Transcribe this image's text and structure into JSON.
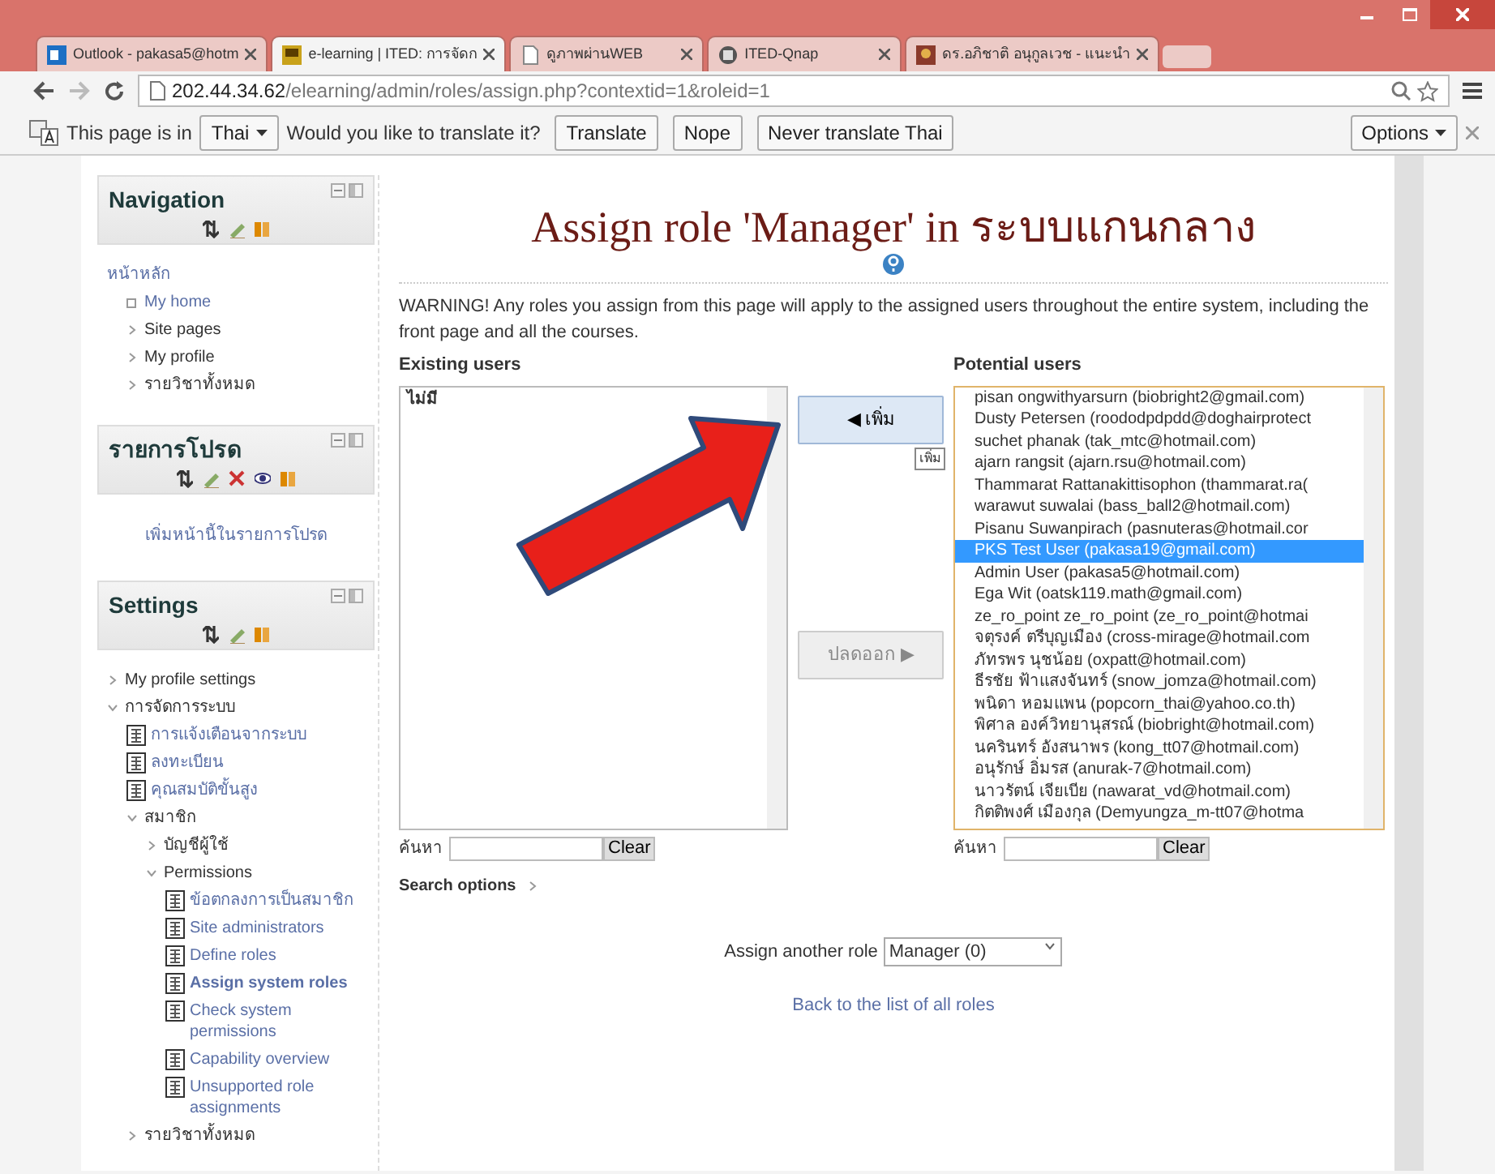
{
  "browser": {
    "tabs": [
      {
        "title": "Outlook - pakasa5@hotm",
        "selected": false,
        "kind": "mail"
      },
      {
        "title": "e-learning | ITED: การจัดก",
        "selected": true,
        "kind": "site"
      },
      {
        "title": "ดูภาพผ่านWEB",
        "selected": false,
        "kind": "page"
      },
      {
        "title": "ITED-Qnap",
        "selected": false,
        "kind": "nas"
      },
      {
        "title": "ดร.อภิชาติ อนุกูลเวช - แนะนำ",
        "selected": false,
        "kind": "photo"
      }
    ],
    "address_host": "202.44.34.62",
    "address_path": "/elearning/admin/roles/assign.php?contextid=1&roleid=1"
  },
  "translate_bar": {
    "text_1": "This page is in",
    "language": "Thai",
    "text_2": "Would you like to translate it?",
    "buttons": [
      "Translate",
      "Nope",
      "Never translate Thai"
    ],
    "options": "Options"
  },
  "sidebar": [
    {
      "title": "Navigation",
      "kind": "plain",
      "items": [
        {
          "label": "หน้าหลัก",
          "kind": "link",
          "children": [
            {
              "label": "My home",
              "kind": "leaf"
            },
            {
              "label": "Site pages",
              "kind": "branch",
              "expanded": false
            },
            {
              "label": "My profile",
              "kind": "branch",
              "expanded": false
            },
            {
              "label": "รายวิชาทั้งหมด",
              "kind": "branch",
              "expanded": false
            }
          ]
        }
      ]
    },
    {
      "title": "รายการโปรด",
      "kind": "favorites",
      "link": "เพิ่มหน้านี้ในรายการโปรด"
    },
    {
      "title": "Settings",
      "kind": "plain",
      "items": [
        {
          "label": "My profile settings",
          "kind": "branch",
          "expanded": false
        },
        {
          "label": "การจัดการระบบ",
          "kind": "branch",
          "expanded": true,
          "children": [
            {
              "label": "การแจ้งเตือนจากระบบ",
              "kind": "page"
            },
            {
              "label": "ลงทะเบียน",
              "kind": "page"
            },
            {
              "label": "คุณสมบัติขั้นสูง",
              "kind": "page"
            },
            {
              "label": "สมาชิก",
              "kind": "branch",
              "expanded": true,
              "children": [
                {
                  "label": "บัญชีผู้ใช้",
                  "kind": "branch",
                  "expanded": false
                },
                {
                  "label": "Permissions",
                  "kind": "branch",
                  "expanded": true,
                  "children": [
                    {
                      "label": "ข้อตกลงการเป็นสมาชิก",
                      "kind": "page",
                      "selected": false
                    },
                    {
                      "label": "Site administrators",
                      "kind": "page",
                      "selected": false
                    },
                    {
                      "label": "Define roles",
                      "kind": "page",
                      "selected": false
                    },
                    {
                      "label": "Assign system roles",
                      "kind": "page",
                      "selected": true
                    },
                    {
                      "label": "Check system permissions",
                      "kind": "page",
                      "selected": false
                    },
                    {
                      "label": "Capability overview",
                      "kind": "page",
                      "selected": false
                    },
                    {
                      "label": "Unsupported role assignments",
                      "kind": "page",
                      "selected": false
                    }
                  ]
                }
              ]
            },
            {
              "label": "รายวิชาทั้งหมด",
              "kind": "branch",
              "expanded": false
            }
          ]
        }
      ]
    }
  ],
  "main": {
    "title_1": "Assign role 'Manager' in ",
    "title_2": "ระบบแกนกลาง",
    "warning": "WARNING! Any roles you assign from this page will apply to the assigned users throughout the entire system, including the front page and all the courses.",
    "existing": {
      "label": "Existing users",
      "items": [
        "ไม่มี"
      ]
    },
    "add_button": "◀ เพิ่ม",
    "add_tooltip": "เพิ่ม",
    "remove_button": {
      "label": "ปลดออก ▶",
      "disabled": true
    },
    "potential": {
      "label": "Potential users",
      "items": [
        {
          "text": "pisan ongwithyarsurn (biobright2@gmail.com)",
          "selected": false
        },
        {
          "text": "Dusty Petersen (roododpdpdd@doghairprotect",
          "selected": false
        },
        {
          "text": "suchet phanak (tak_mtc@hotmail.com)",
          "selected": false
        },
        {
          "text": "ajarn rangsit (ajarn.rsu@hotmail.com)",
          "selected": false
        },
        {
          "text": "Thammarat Rattanakittisophon (thammarat.ra(",
          "selected": false
        },
        {
          "text": "warawut suwalai (bass_ball2@hotmail.com)",
          "selected": false
        },
        {
          "text": "Pisanu Suwanpirach (pasnuteras@hotmail.cor",
          "selected": false
        },
        {
          "text": "PKS Test User (pakasa19@gmail.com)",
          "selected": true
        },
        {
          "text": "Admin User (pakasa5@hotmail.com)",
          "selected": false
        },
        {
          "text": "Ega Wit (oatsk119.math@gmail.com)",
          "selected": false
        },
        {
          "text": "ze_ro_point ze_ro_point (ze_ro_point@hotmai",
          "selected": false
        },
        {
          "text": "จตุรงค์ ตรีบุญเมือง (cross-mirage@hotmail.com",
          "selected": false
        },
        {
          "text": "ภัทรพร นุชน้อย (oxpatt@hotmail.com)",
          "selected": false
        },
        {
          "text": "ธีรชัย ฟ้าแสงจันทร์ (snow_jomza@hotmail.com)",
          "selected": false
        },
        {
          "text": "พนิดา หอมแพน (popcorn_thai@yahoo.co.th)",
          "selected": false
        },
        {
          "text": "พิศาล องค์วิทยานุสรณ์ (biobright@hotmail.com)",
          "selected": false
        },
        {
          "text": "นครินทร์ อังสนาพร (kong_tt07@hotmail.com)",
          "selected": false
        },
        {
          "text": "อนุรักษ์ อิ่มรส (anurak-7@hotmail.com)",
          "selected": false
        },
        {
          "text": "นาวรัตน์ เจียเบีย (nawarat_vd@hotmail.com)",
          "selected": false
        },
        {
          "text": "กิตติพงศ์ เมืองกุล (Demyungza_m-tt07@hotma",
          "selected": false
        }
      ]
    },
    "existing_search": {
      "label": "ค้นหา",
      "clear": "Clear"
    },
    "potential_search": {
      "label": "ค้นหา",
      "clear": "Clear"
    },
    "search_options": "Search options",
    "assign_label": "Assign another role",
    "assign_value": "Manager (0)",
    "back_link": "Back to the list of all roles"
  }
}
